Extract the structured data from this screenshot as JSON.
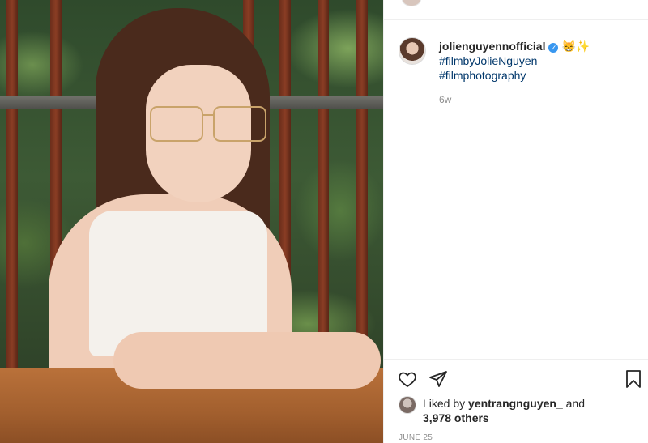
{
  "post": {
    "username": "jolienguyennofficial",
    "verified_symbol": "✓",
    "emojis": "😸✨",
    "hashtags": [
      "#filmbyJolieNguyen",
      "#filmphotography"
    ],
    "time_ago": "6w"
  },
  "likes": {
    "prefix": "Liked by ",
    "liker": "yentrangnguyen_",
    "joiner": " and",
    "others": "3,978 others"
  },
  "date": "JUNE 25",
  "icons": {
    "like": "heart-icon",
    "share": "paper-plane-icon",
    "save": "bookmark-icon"
  },
  "colors": {
    "hashtag": "#00376b",
    "verified": "#3897f0",
    "muted": "#8e8e8e"
  }
}
